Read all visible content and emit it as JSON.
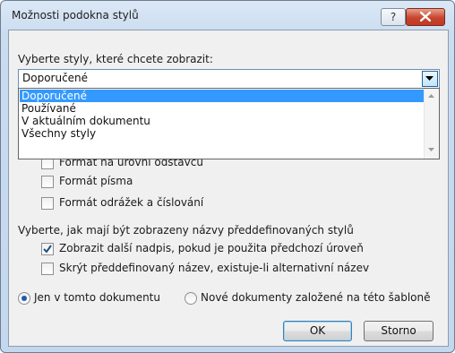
{
  "window": {
    "title": "Možnosti podokna stylů"
  },
  "labels": {
    "select_styles": "Vyberte styly, které chcete zobrazit:",
    "naming_heading": "Vyberte, jak mají být zobrazeny názvy předdefinovaných stylů"
  },
  "combo": {
    "value": "Doporučené"
  },
  "dropdown": {
    "options": [
      "Doporučené",
      "Používané",
      "V aktuálním dokumentu",
      "Všechny styly"
    ],
    "selected": "Doporučené"
  },
  "format_checks": [
    {
      "label": "Formát na úrovni odstavců",
      "checked": false
    },
    {
      "label": "Formát písma",
      "checked": false
    },
    {
      "label": "Formát odrážek a číslování",
      "checked": false
    }
  ],
  "name_checks": [
    {
      "label": "Zobrazit další nadpis, pokud je použita předchozí úroveň",
      "checked": true
    },
    {
      "label": "Skrýt předdefinovaný název, existuje-li alternativní název",
      "checked": false
    }
  ],
  "scope": [
    {
      "label": "Jen v tomto dokumentu",
      "selected": true
    },
    {
      "label": "Nové dokumenty založené na této šabloně",
      "selected": false
    }
  ],
  "buttons": {
    "ok": "OK",
    "cancel": "Storno"
  },
  "colors": {
    "selection": "#3399ff",
    "title_gradient_top": "#dbe8f6",
    "close_button": "#c7442e"
  }
}
